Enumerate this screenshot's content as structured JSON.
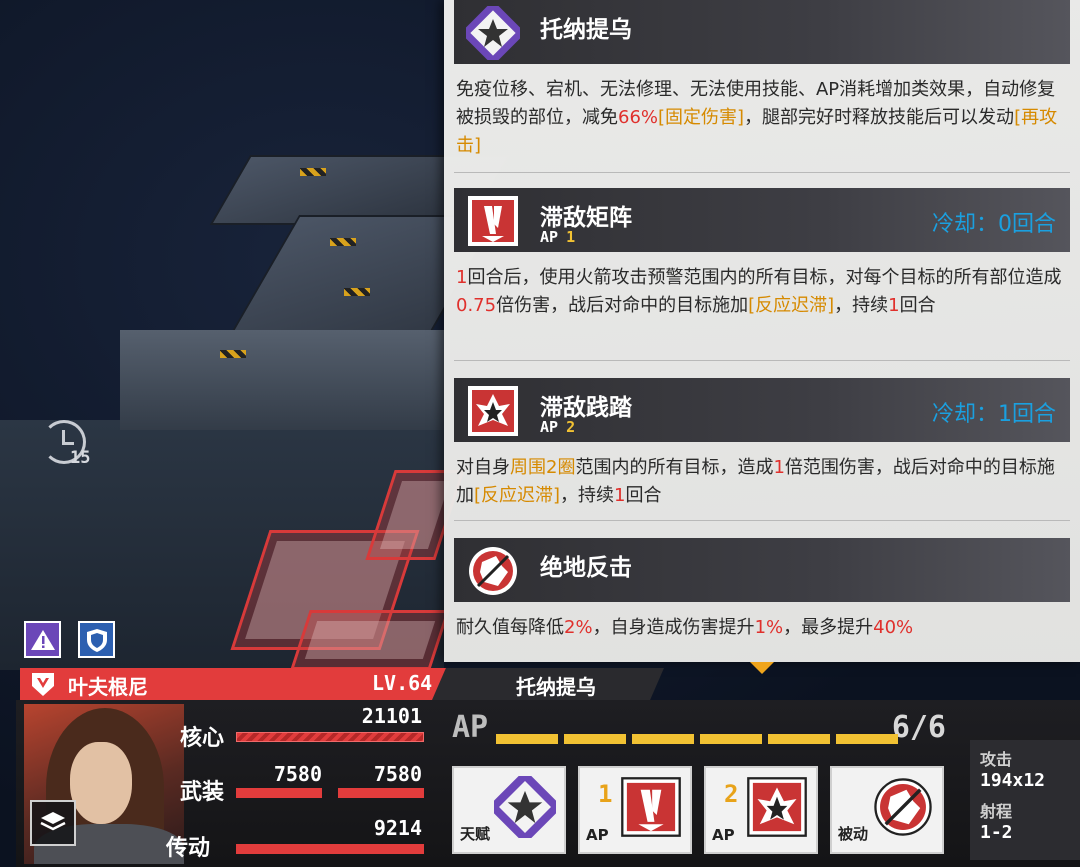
{
  "timer": {
    "turns": "15"
  },
  "panel": {
    "skills": [
      {
        "name": "托纳提乌",
        "icon": "star-emblem-icon",
        "desc_parts": [
          {
            "t": "免疫位移、宕机、无法修理、无法使用技能、AP消耗增加类效果，自动修复被损毁的部位，减免",
            "c": ""
          },
          {
            "t": "66%",
            "c": "red"
          },
          {
            "t": "[固定伤害]",
            "c": "gold"
          },
          {
            "t": "，腿部完好时释放技能后可以发动",
            "c": ""
          },
          {
            "t": "[再攻击]",
            "c": "gold"
          }
        ]
      },
      {
        "name": "滞敌矩阵",
        "icon": "rocket-volley-icon",
        "ap_label": "AP",
        "ap": "1",
        "cooldown": "冷却：0回合",
        "desc_parts": [
          {
            "t": "1",
            "c": "red"
          },
          {
            "t": "回合后，使用火箭攻击预警范围内的所有目标，对每个目标的所有部位造成",
            "c": ""
          },
          {
            "t": "0.75",
            "c": "red"
          },
          {
            "t": "倍伤害，战后对命中的目标施加",
            "c": ""
          },
          {
            "t": "[反应迟滞]",
            "c": "gold"
          },
          {
            "t": "，持续",
            "c": ""
          },
          {
            "t": "1",
            "c": "red"
          },
          {
            "t": "回合",
            "c": ""
          }
        ]
      },
      {
        "name": "滞敌践踏",
        "icon": "stomp-icon",
        "ap_label": "AP",
        "ap": "2",
        "cooldown": "冷却：1回合",
        "desc_parts": [
          {
            "t": "对自身",
            "c": ""
          },
          {
            "t": "周围2圈",
            "c": "gold"
          },
          {
            "t": "范围内的所有目标，造成",
            "c": ""
          },
          {
            "t": "1",
            "c": "red"
          },
          {
            "t": "倍范围伤害，战后对命中的目标施加",
            "c": ""
          },
          {
            "t": "[反应迟滞]",
            "c": "gold"
          },
          {
            "t": "，持续",
            "c": ""
          },
          {
            "t": "1",
            "c": "red"
          },
          {
            "t": "回合",
            "c": ""
          }
        ]
      },
      {
        "name": "绝地反击",
        "icon": "counterattack-icon",
        "desc_parts": [
          {
            "t": "耐久值每降低",
            "c": ""
          },
          {
            "t": "2%",
            "c": "red"
          },
          {
            "t": "，自身造成伤害提升",
            "c": ""
          },
          {
            "t": "1%",
            "c": "red"
          },
          {
            "t": "，最多提升",
            "c": ""
          },
          {
            "t": "40%",
            "c": "red"
          }
        ]
      }
    ]
  },
  "unit": {
    "name": "叶夫根尼",
    "level": "LV.64",
    "mech_name": "托纳提乌",
    "stats": {
      "core_label": "核心",
      "core_value": "21101",
      "arms_label": "武装",
      "arms_left": "7580",
      "arms_right": "7580",
      "drive_label": "传动",
      "drive_value": "9214"
    },
    "ap_label": "AP",
    "ap_value": "6/6",
    "ap_current": 6,
    "ap_max": 6,
    "cards": [
      {
        "tag": "天赋",
        "num": "",
        "icon": "star-emblem-icon"
      },
      {
        "tag": "AP",
        "num": "1",
        "icon": "rocket-volley-icon"
      },
      {
        "tag": "AP",
        "num": "2",
        "icon": "stomp-icon"
      },
      {
        "tag": "被动",
        "num": "",
        "icon": "counterattack-icon"
      }
    ],
    "weapon": {
      "attack_label": "攻击",
      "attack_value": "194x12",
      "range_label": "射程",
      "range_value": "1-2"
    }
  },
  "colors": {
    "accent_red": "#e23c3c",
    "accent_gold": "#f2c233",
    "cooldown_blue": "#1aa0e0",
    "status_purple": "#6b47b8",
    "status_blue": "#2c5fb0"
  }
}
